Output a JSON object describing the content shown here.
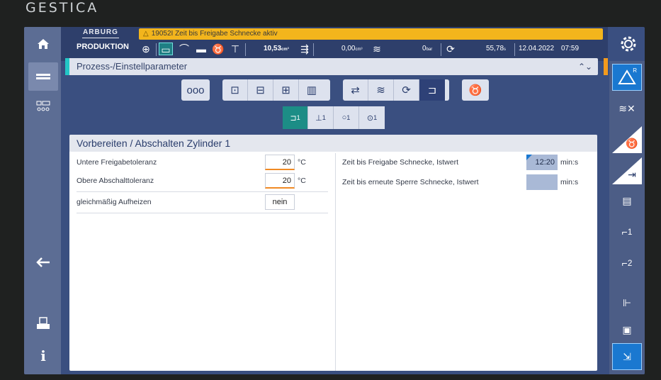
{
  "brand": "GESTICA",
  "header": {
    "logo": "ARBURG",
    "mode": "PRODUKTION",
    "alarm": "19052I Zeit bis Freigabe Schnecke aktiv",
    "status": {
      "shot_volume": "10,53",
      "shot_volume_unit": "cm³",
      "volume2": "0,00",
      "volume2_unit": "cm³",
      "pressure": "0",
      "pressure_unit": "bar",
      "cycle_time": "55,78",
      "cycle_unit": "s",
      "date": "12.04.2022",
      "time": "07:59"
    }
  },
  "process_bar": {
    "title": "Prozess-/Einstellparameter"
  },
  "panel": {
    "title": "Vorbereiten / Abschalten Zylinder 1",
    "left_rows": [
      {
        "label": "Untere Freigabetoleranz",
        "value": "20",
        "unit": "°C"
      },
      {
        "label": "Obere Abschalttoleranz",
        "value": "20",
        "unit": "°C"
      },
      {
        "label": "gleichmäßig Aufheizen",
        "value": "nein",
        "unit": ""
      }
    ],
    "right_rows": [
      {
        "label": "Zeit bis Freigabe Schnecke, Istwert",
        "value": "12:20",
        "unit": "min:s"
      },
      {
        "label": "Zeit bis erneute Sperre Schnecke, Istwert",
        "value": "",
        "unit": "min:s"
      }
    ]
  },
  "toolbar2": {
    "labels": [
      "1",
      "1",
      "1",
      "1"
    ]
  },
  "right_bar": {
    "btn_a": "R",
    "btn_b": "1",
    "btn_c": "2"
  },
  "icons": {
    "home": "home-icon",
    "menu": "menu-icon",
    "machine": "machine-icon",
    "back": "back-arrow-icon",
    "print": "print-icon",
    "info": "info-icon",
    "gear": "gear-icon"
  },
  "colors": {
    "alarm": "#f3b51c",
    "accent_teal": "#1c8d86",
    "accent_orange": "#f08a24"
  }
}
